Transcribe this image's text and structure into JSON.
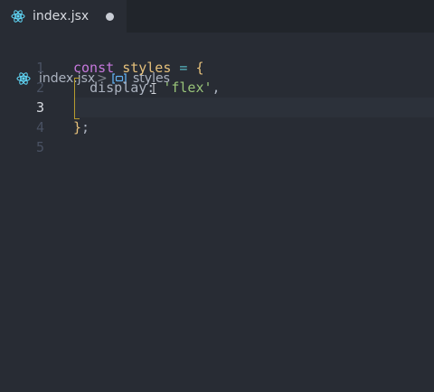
{
  "tab": {
    "label": "index.jsx",
    "icon": "react-icon",
    "modified": true
  },
  "breadcrumb": {
    "file": "index.jsx",
    "separator": ">",
    "symbol_icon": "variable-symbol-icon",
    "symbol": "styles"
  },
  "editor": {
    "line_numbers": [
      "1",
      "2",
      "3",
      "4",
      "5"
    ],
    "active_line": "3",
    "lines": [
      {
        "kw": "const",
        "var": "styles",
        "op": "=",
        "brace": "{"
      },
      {
        "prop": "display",
        "punct": ":",
        "str": "'flex'",
        "comma": ","
      },
      {},
      {
        "brace": "}",
        "semi": ";"
      },
      {}
    ]
  },
  "colors": {
    "background": "#282c34",
    "keyword": "#c678dd",
    "variable": "#e5c07b",
    "string": "#98c379",
    "operator": "#56b6c2",
    "react": "#61dafb"
  }
}
